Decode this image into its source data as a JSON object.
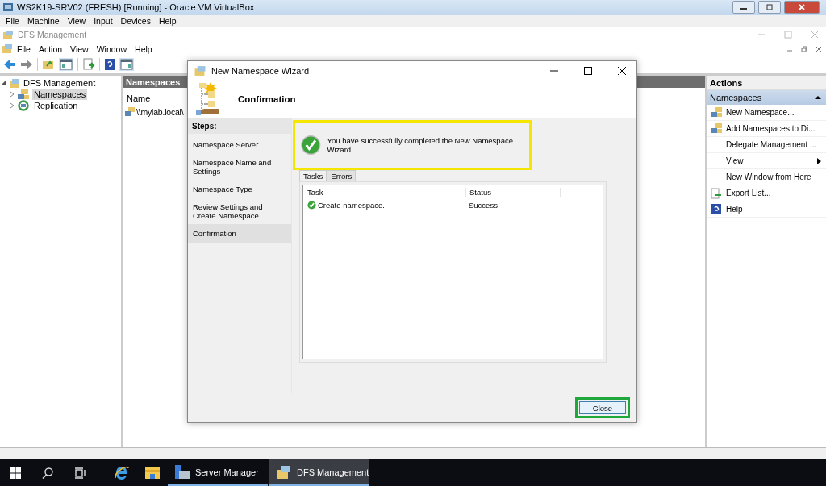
{
  "vbox": {
    "title": "WS2K19-SRV02 (FRESH) [Running] - Oracle VM VirtualBox",
    "menu": [
      "File",
      "Machine",
      "View",
      "Input",
      "Devices",
      "Help"
    ]
  },
  "mmc": {
    "title": "DFS Management",
    "menu": [
      "File",
      "Action",
      "View",
      "Window",
      "Help"
    ]
  },
  "tree": [
    {
      "label": "DFS Management",
      "expanded": true,
      "selected": false,
      "children": [
        {
          "label": "Namespaces",
          "kind": "namespaces",
          "selected": true
        },
        {
          "label": "Replication",
          "kind": "replication",
          "selected": false
        }
      ]
    }
  ],
  "center": {
    "header": "Namespaces",
    "column": "Name",
    "rows": [
      "\\\\mylab.local\\"
    ]
  },
  "actions": {
    "header": "Actions",
    "section": "Namespaces",
    "expanded": true,
    "items": [
      {
        "label": "New Namespace...",
        "kind": "namespace",
        "submenu": false
      },
      {
        "label": "Add Namespaces to Di...",
        "kind": "namespace",
        "submenu": false
      },
      {
        "label": "Delegate Management ...",
        "kind": "plain",
        "submenu": false
      },
      {
        "label": "View",
        "kind": "plain",
        "submenu": true
      },
      {
        "label": "New Window from Here",
        "kind": "plain",
        "submenu": false
      },
      {
        "label": "Export List...",
        "kind": "export",
        "submenu": false
      },
      {
        "label": "Help",
        "kind": "help",
        "submenu": false
      }
    ]
  },
  "wizard": {
    "title": "New Namespace Wizard",
    "heading": "Confirmation",
    "steps_label": "Steps:",
    "steps": [
      {
        "label": "Namespace Server",
        "selected": false
      },
      {
        "label": "Namespace Name and Settings",
        "selected": false
      },
      {
        "label": "Namespace Type",
        "selected": false
      },
      {
        "label": "Review Settings and Create Namespace",
        "selected": false
      },
      {
        "label": "Confirmation",
        "selected": true
      }
    ],
    "message": "You have successfully completed the New Namespace Wizard.",
    "tabs": [
      {
        "label": "Tasks",
        "selected": true
      },
      {
        "label": "Errors",
        "selected": false
      }
    ],
    "columns": [
      "Task",
      "Status"
    ],
    "rows": [
      {
        "task": "Create namespace.",
        "status": "Success"
      }
    ],
    "button": "Close"
  },
  "taskbar": [
    {
      "kind": "ie",
      "selected": false
    },
    {
      "kind": "explorer",
      "selected": false
    },
    {
      "label": "Server Manager",
      "kind": "server",
      "selected": false
    },
    {
      "label": "DFS Management",
      "kind": "dfs",
      "selected": true
    }
  ]
}
